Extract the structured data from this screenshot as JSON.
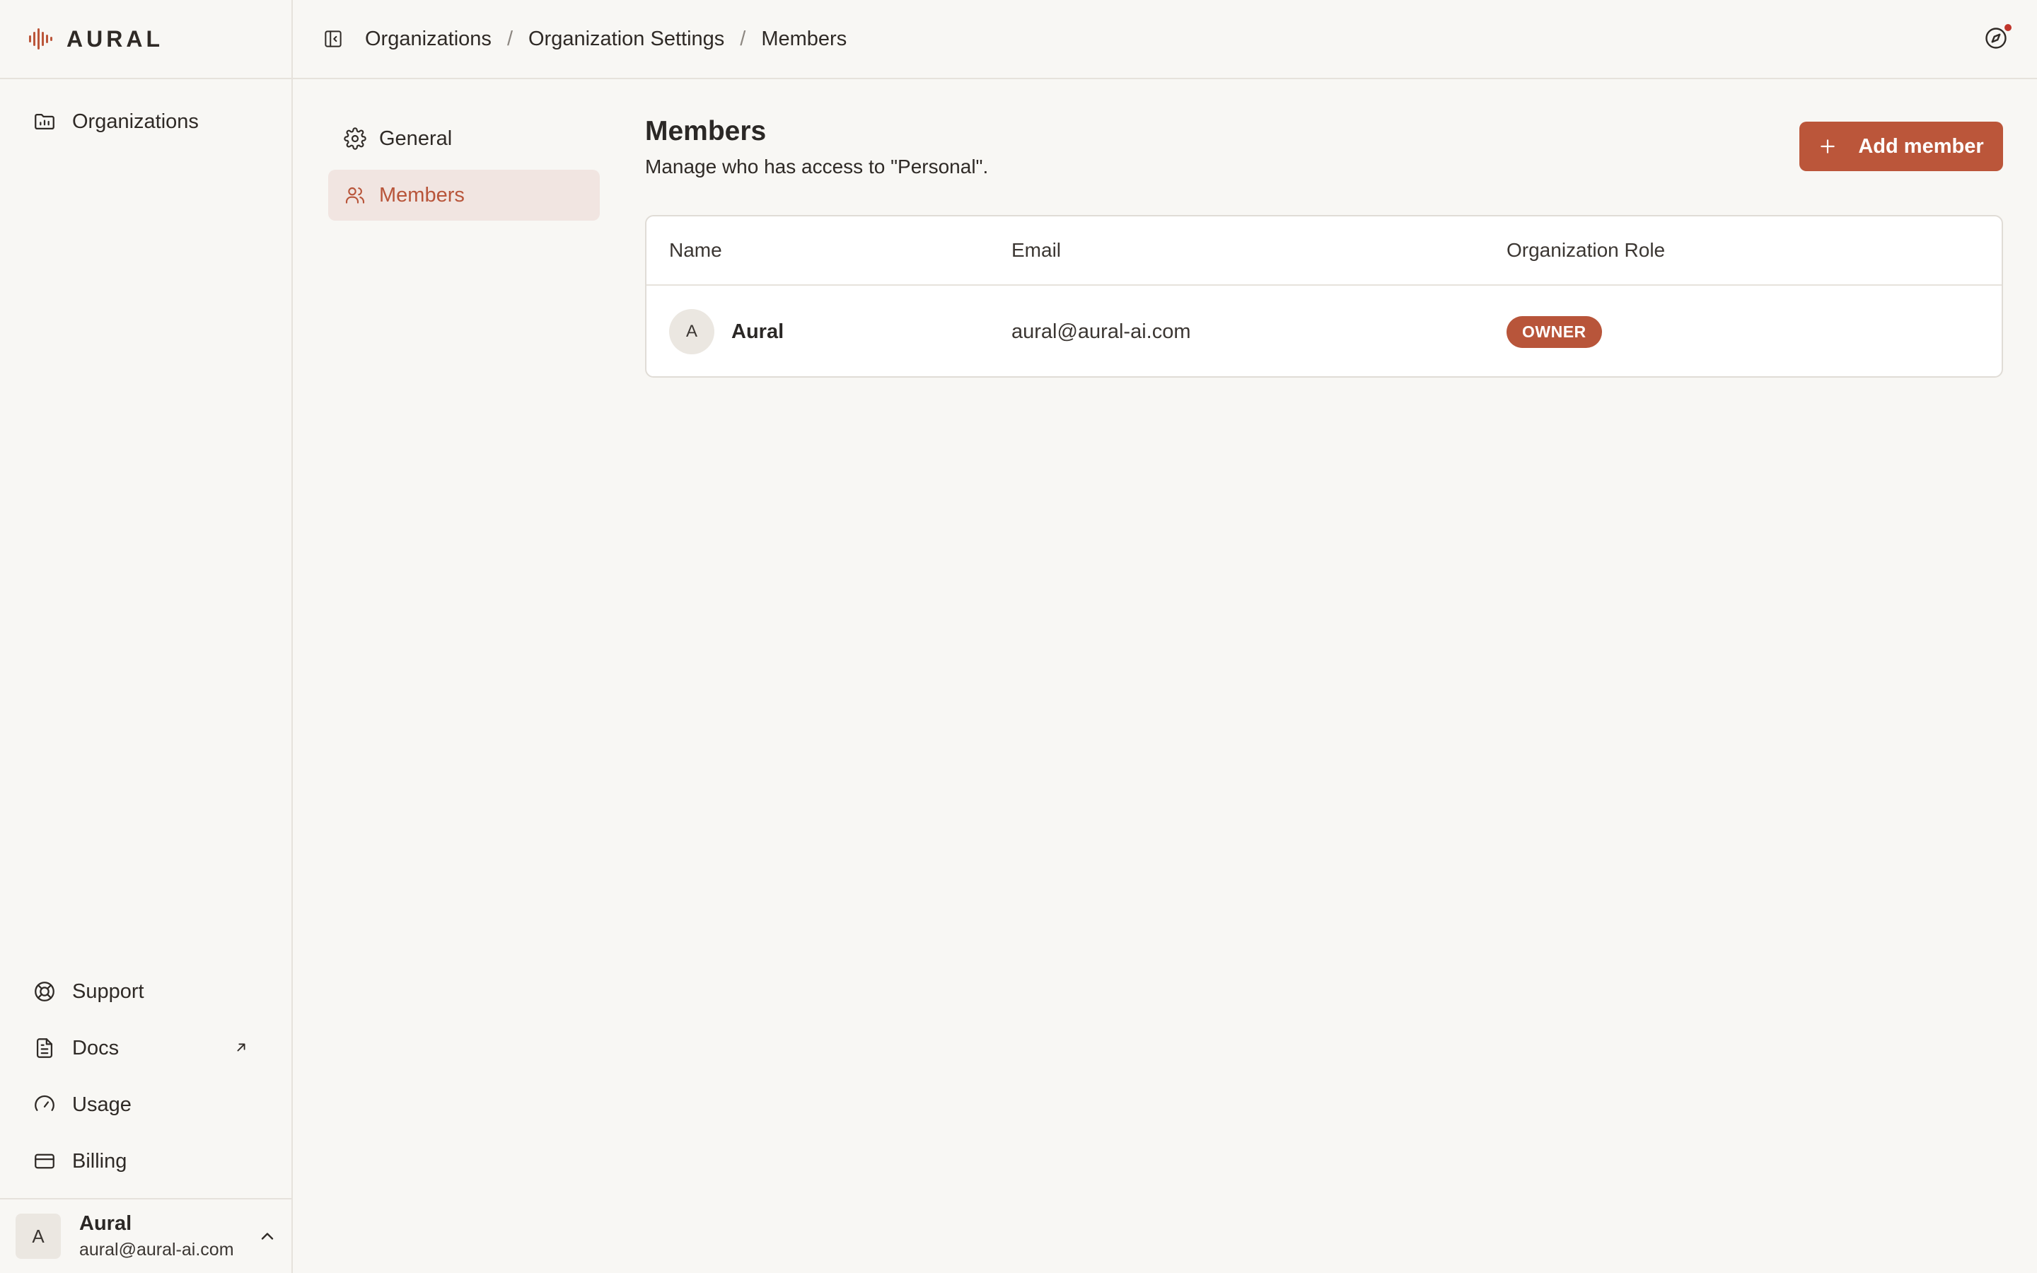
{
  "app": {
    "logo_text": "AURAL"
  },
  "colors": {
    "accent": "#bb563a",
    "accent_soft": "#f1e5e1",
    "background": "#f8f7f4",
    "notification": "#c0352b"
  },
  "sidebar": {
    "top_items": [
      {
        "label": "Organizations",
        "icon": "folder-chart-icon"
      }
    ],
    "bottom_items": [
      {
        "label": "Support",
        "icon": "lifebuoy-icon"
      },
      {
        "label": "Docs",
        "icon": "document-icon",
        "external": true
      },
      {
        "label": "Usage",
        "icon": "gauge-icon"
      },
      {
        "label": "Billing",
        "icon": "credit-card-icon"
      }
    ],
    "user": {
      "avatar_initial": "A",
      "name": "Aural",
      "email": "aural@aural-ai.com"
    }
  },
  "breadcrumb": {
    "items": [
      "Organizations",
      "Organization Settings",
      "Members"
    ],
    "separator": "/"
  },
  "settings_nav": {
    "items": [
      {
        "label": "General",
        "icon": "gear-icon",
        "active": false
      },
      {
        "label": "Members",
        "icon": "users-icon",
        "active": true
      }
    ]
  },
  "main": {
    "title": "Members",
    "subtitle": "Manage who has access to \"Personal\".",
    "add_button_label": "Add member",
    "table": {
      "columns": [
        "Name",
        "Email",
        "Organization Role"
      ],
      "rows": [
        {
          "avatar_initial": "A",
          "name": "Aural",
          "email": "aural@aural-ai.com",
          "role": "OWNER"
        }
      ]
    }
  }
}
